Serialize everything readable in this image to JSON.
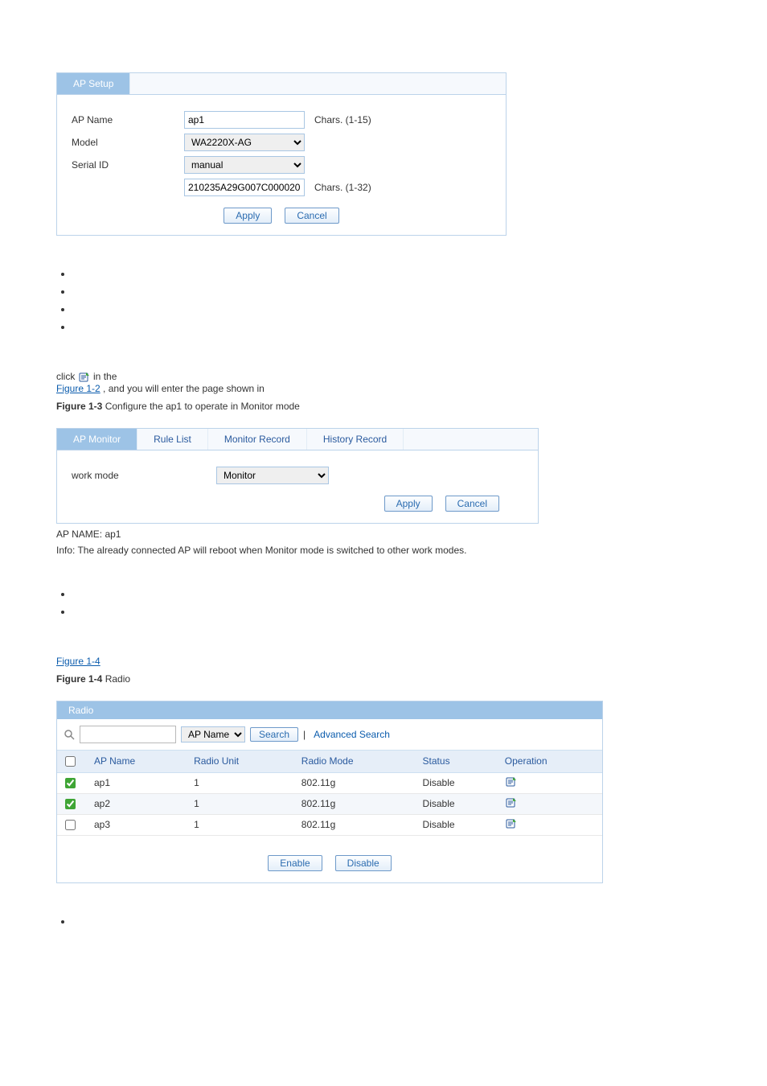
{
  "ap_setup": {
    "tab": "AP Setup",
    "fields": {
      "ap_name_label": "AP Name",
      "ap_name_value": "ap1",
      "ap_name_hint": "Chars. (1-15)",
      "model_label": "Model",
      "model_value": "WA2220X-AG",
      "serial_label": "Serial ID",
      "serial_value": "manual",
      "serial_number": "210235A29G007C000020",
      "serial_hint": "Chars. (1-32)"
    },
    "apply": "Apply",
    "cancel": "Cancel"
  },
  "text": {
    "pre_fig2": "in the ",
    "fig2_link": "Figure 1-2",
    "post_fig2": ", and you will enter the page shown in ",
    "fig3_fig_line": "click ",
    "fig3_caption_id": "Figure 1-3",
    "fig3_caption": " Configure the ap1 to operate in Monitor mode"
  },
  "ap_monitor": {
    "tabs": [
      "AP Monitor",
      "Rule List",
      "Monitor Record",
      "History Record"
    ],
    "work_mode_label": "work mode",
    "work_mode_value": "Monitor",
    "apply": "Apply",
    "cancel": "Cancel",
    "ap_name_line": "AP NAME: ap1",
    "info_line": "Info: The already connected AP will reboot when Monitor mode is switched to other work modes."
  },
  "fig4_link": "Figure 1-4",
  "radio_caption_id": "Figure 1-4",
  "radio_caption": " Radio",
  "radio": {
    "header": "Radio",
    "search_options": [
      "AP Name"
    ],
    "search_btn": "Search",
    "adv_search": "Advanced Search",
    "columns": [
      "AP Name",
      "Radio Unit",
      "Radio Mode",
      "Status",
      "Operation"
    ],
    "rows": [
      {
        "checked": true,
        "ap": "ap1",
        "unit": "1",
        "mode": "802.11g",
        "status": "Disable"
      },
      {
        "checked": true,
        "ap": "ap2",
        "unit": "1",
        "mode": "802.11g",
        "status": "Disable"
      },
      {
        "checked": false,
        "ap": "ap3",
        "unit": "1",
        "mode": "802.11g",
        "status": "Disable"
      }
    ],
    "enable": "Enable",
    "disable": "Disable"
  }
}
